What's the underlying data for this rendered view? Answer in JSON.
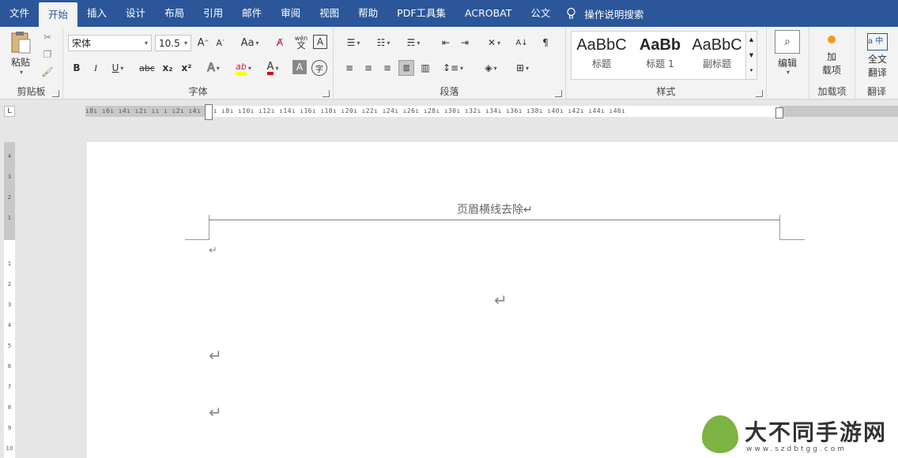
{
  "tabs": [
    "文件",
    "开始",
    "插入",
    "设计",
    "布局",
    "引用",
    "邮件",
    "审阅",
    "视图",
    "帮助",
    "PDF工具集",
    "ACROBAT",
    "公文"
  ],
  "tell_me": "操作说明搜索",
  "clipboard": {
    "paste": "粘贴",
    "label": "剪贴板"
  },
  "font": {
    "name": "宋体",
    "size": "10.5",
    "grow": "A",
    "shrink": "A",
    "case": "Aa",
    "pinyin": "wén",
    "border_char": "A",
    "bold": "B",
    "italic": "I",
    "underline": "U",
    "strike": "abc",
    "sub": "x₂",
    "sup": "x²",
    "effects": "A",
    "highlight": "ab",
    "color": "A",
    "shading": "A",
    "enclose": "字",
    "label": "字体"
  },
  "paragraph": {
    "label": "段落"
  },
  "styles": {
    "items": [
      {
        "preview": "AaBbC",
        "name": "标题"
      },
      {
        "preview": "AaBb",
        "name": "标题 1"
      },
      {
        "preview": "AaBbC",
        "name": "副标题"
      }
    ],
    "label": "样式"
  },
  "editing": {
    "label": "编辑"
  },
  "addins": {
    "btn_line1": "加",
    "btn_line2": "载项",
    "label": "加载项"
  },
  "translate": {
    "btn_line1": "全文",
    "btn_line2": "翻译",
    "label": "翻译"
  },
  "ruler": {
    "ticks": "ı8ı ı6ı ı4ı ı2ı ıı ı ı2ı ı4ı ı6ı ı8ı ı10ı ı12ı ı14ı ı16ı ı18ı ı20ı ı22ı ı24ı ı26ı ı28ı ı30ı ı32ı ı34ı ı36ı ı38ı ı40ı ı42ı ı44ı ı46ı",
    "vticks": [
      "4",
      "3",
      "2",
      "1",
      "1",
      "2",
      "3",
      "4",
      "5",
      "6",
      "7",
      "8",
      "9",
      "10"
    ]
  },
  "document": {
    "header_text": "页眉横线去除↵",
    "marks": [
      "↵",
      "↵",
      "↵",
      "↵"
    ]
  },
  "watermark": {
    "text": "大不同手游网",
    "url": "www.szdbtgg.com"
  },
  "colors": {
    "accent": "#2b579a",
    "highlight": "#ffff00",
    "font_color": "#e00000"
  }
}
